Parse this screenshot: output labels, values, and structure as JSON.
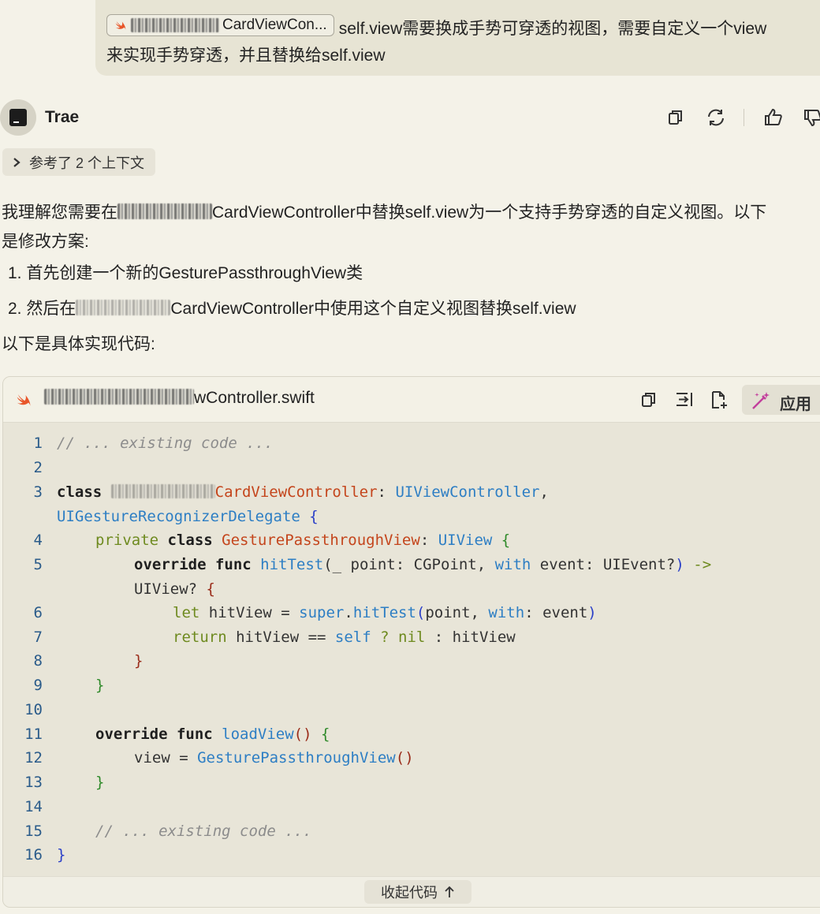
{
  "user_message": {
    "chip_label": "CardViewCon...",
    "line1": "self.view需要换成手势可穿透的视图，需要自定义一个view",
    "line2": "来实现手势穿透，并且替换给self.view"
  },
  "assistant": {
    "name": "Trae",
    "context_label": "参考了 2 个上下文"
  },
  "response": {
    "p1_a": "我理解您需要在",
    "p1_b": "CardViewController中替换self.view为一个支持手势穿透的自定义视图。以下",
    "p1_c": "是修改方案:",
    "step1": "1. 首先创建一个新的GesturePassthroughView类",
    "step2_a": "2. 然后在",
    "step2_b": "CardViewController中使用这个自定义视图替换self.view",
    "intro": "以下是具体实现代码:"
  },
  "code_block": {
    "file_suffix": "wController.swift",
    "apply_label": "应用",
    "collapse_label": "收起代码",
    "line_numbers": [
      "1",
      "2",
      "3",
      "4",
      "5",
      "6",
      "7",
      "8",
      "9",
      "10",
      "11",
      "12",
      "13",
      "14",
      "15",
      "16"
    ],
    "lines": {
      "l1": "// ... existing code ...",
      "l3_kw": "class ",
      "l3_name": "CardViewController",
      "l3_rest1": ": ",
      "l3_t1": "UIViewController",
      "l3_comma": ",",
      "l3b_t": "UIGestureRecognizerDelegate",
      "l3b_brace": " {",
      "l4_priv": "private ",
      "l4_cls": "class ",
      "l4_name": "GesturePassthroughView",
      "l4_colon": ": ",
      "l4_t": "UIView",
      "l4_brace": " {",
      "l5_ov": "override func ",
      "l5_fn": "hitTest",
      "l5_p1": "(_ point: CGPoint, ",
      "l5_with": "with",
      "l5_p2": " event: UIEvent?",
      "l5_close": ")",
      "l5_arrow": " ->",
      "l5b_t": "UIView? ",
      "l5b_brace": "{",
      "l6_let": "let ",
      "l6_var": "hitView = ",
      "l6_super": "super",
      "l6_dot": ".",
      "l6_fn": "hitTest",
      "l6_open": "(",
      "l6_mid": "point, ",
      "l6_with": "with",
      "l6_end": ": event",
      "l6_close": ")",
      "l7_ret": "return ",
      "l7_a": "hitView == ",
      "l7_self": "self",
      "l7_q": " ? ",
      "l7_nil": "nil",
      "l7_b": " : hitView",
      "l8": "}",
      "l9": "}",
      "l11_ov": "override func ",
      "l11_fn": "loadView",
      "l11_p": "()",
      "l11_brace": " {",
      "l12_a": "view = ",
      "l12_t": "GesturePassthroughView",
      "l12_p": "()",
      "l13": "}",
      "l15": "// ... existing code ...",
      "l16": "}"
    }
  }
}
